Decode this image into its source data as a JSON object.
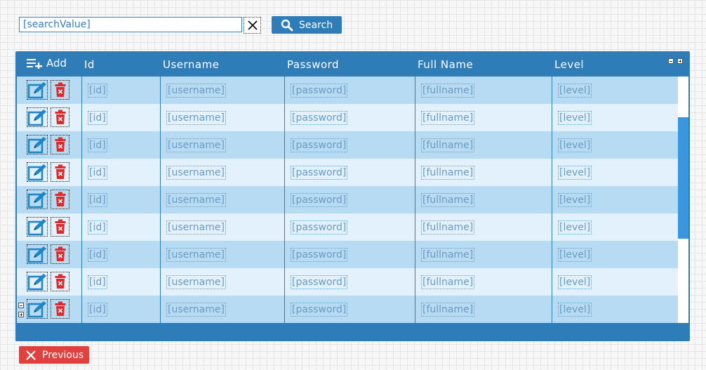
{
  "search": {
    "value": "[searchValue]",
    "button_label": "Search"
  },
  "grid": {
    "add_label": "Add",
    "columns": [
      "Id",
      "Username",
      "Password",
      "Full Name",
      "Level"
    ],
    "rows": [
      {
        "id": "[id]",
        "username": "[username]",
        "password": "[password]",
        "fullname": "[fullname]",
        "level": "[level]"
      },
      {
        "id": "[id]",
        "username": "[username]",
        "password": "[password]",
        "fullname": "[fullname]",
        "level": "[level]"
      },
      {
        "id": "[id]",
        "username": "[username]",
        "password": "[password]",
        "fullname": "[fullname]",
        "level": "[level]"
      },
      {
        "id": "[id]",
        "username": "[username]",
        "password": "[password]",
        "fullname": "[fullname]",
        "level": "[level]"
      },
      {
        "id": "[id]",
        "username": "[username]",
        "password": "[password]",
        "fullname": "[fullname]",
        "level": "[level]"
      },
      {
        "id": "[id]",
        "username": "[username]",
        "password": "[password]",
        "fullname": "[fullname]",
        "level": "[level]"
      },
      {
        "id": "[id]",
        "username": "[username]",
        "password": "[password]",
        "fullname": "[fullname]",
        "level": "[level]"
      },
      {
        "id": "[id]",
        "username": "[username]",
        "password": "[password]",
        "fullname": "[fullname]",
        "level": "[level]"
      },
      {
        "id": "[id]",
        "username": "[username]",
        "password": "[password]",
        "fullname": "[fullname]",
        "level": "[level]"
      }
    ]
  },
  "nav": {
    "previous_label": "Previous"
  },
  "icons": {
    "clear": "close-icon",
    "search": "magnifier-icon",
    "add": "playlist-add-icon",
    "edit": "edit-icon",
    "delete": "trash-icon",
    "previous": "close-x-icon"
  },
  "colors": {
    "primary": "#2f7db8",
    "row_odd": "#b6dbf3",
    "row_even": "#e2f1fc",
    "delete": "#e0413f",
    "scroll_thumb": "#3a96dd"
  }
}
